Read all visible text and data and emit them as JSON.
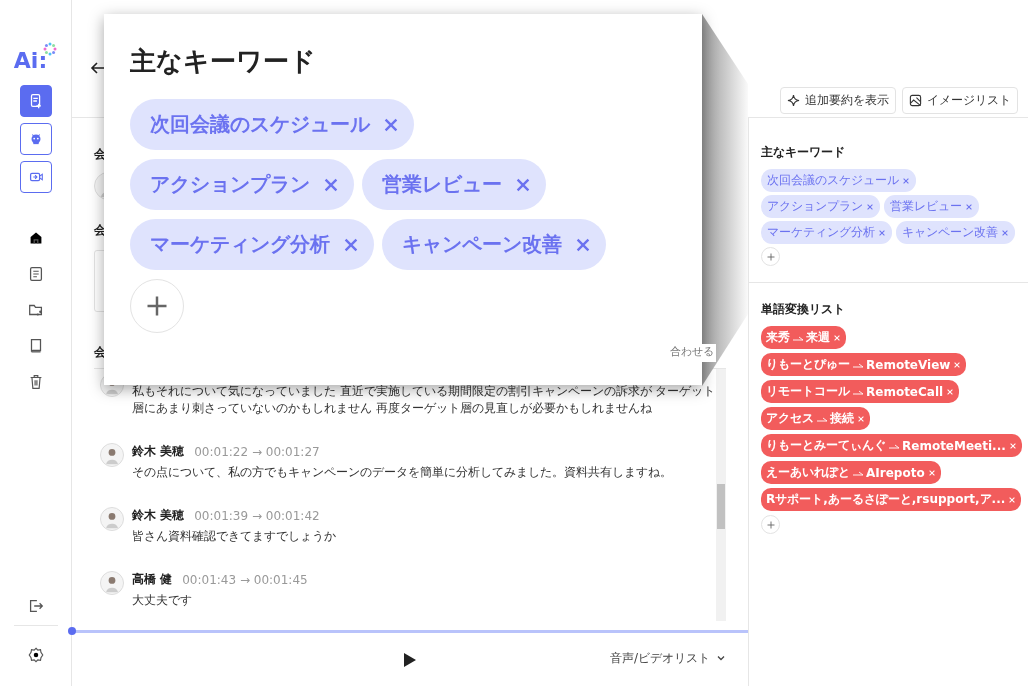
{
  "sidebar": {
    "logo": "Ai:",
    "actions": [
      {
        "selected": true
      },
      {
        "selected": false
      },
      {
        "selected": false
      }
    ]
  },
  "header": {
    "buttons": [
      {
        "label": "追加要約を表示",
        "kind": "sparkle"
      },
      {
        "label": "イメージリスト",
        "kind": "image"
      }
    ]
  },
  "content": {
    "labels": [
      "会",
      "会",
      "会"
    ],
    "fit_label": "合わせる"
  },
  "transcript": [
    {
      "text": "私もそれについて気になっていました 直近で実施している期間限定の割引キャンペーンの訴求が ターゲット層にあまり刺さっていないのかもしれません 再度ターゲット層の見直しが必要かもしれませんね"
    },
    {
      "name": "鈴木 美穂",
      "time": "00:01:22 → 00:01:27",
      "text": "その点について、私の方でもキャンペーンのデータを簡単に分析してみました。資料共有しますね。"
    },
    {
      "name": "鈴木 美穂",
      "time": "00:01:39 → 00:01:42",
      "text": "皆さん資料確認できてますでしょうか"
    },
    {
      "name": "高橋 健",
      "time": "00:01:43 → 00:01:45",
      "text": "大丈夫です"
    }
  ],
  "player": {
    "level": 0,
    "list_label": "音声/ビデオリスト"
  },
  "keywords": {
    "title": "主なキーワード",
    "items": [
      "次回会議のスケジュール",
      "アクションプラン",
      "営業レビュー",
      "マーケティング分析",
      "キャンペーン改善"
    ]
  },
  "replacements": {
    "title": "単語変換リスト",
    "items": [
      {
        "from": "来秀",
        "to": "来週"
      },
      {
        "from": "りもーとぴゅー",
        "to": "RemoteView"
      },
      {
        "from": "リモートコール",
        "to": "RemoteCall"
      },
      {
        "from": "アクセス",
        "to": "接続"
      },
      {
        "from": "りもーとみーてぃんぐ",
        "to": "RemoteMeeti..."
      },
      {
        "from": "えーあいれぽと",
        "to": "AIrepoto"
      },
      {
        "from": "Rサポート,あーるさぽーと,rsupport,ア..."
      }
    ]
  },
  "zoom_popup": {
    "title": "主なキーワード",
    "items": [
      "次回会議のスケジュール",
      "アクションプラン",
      "営業レビュー",
      "マーケティング分析",
      "キャンペーン改善"
    ]
  }
}
